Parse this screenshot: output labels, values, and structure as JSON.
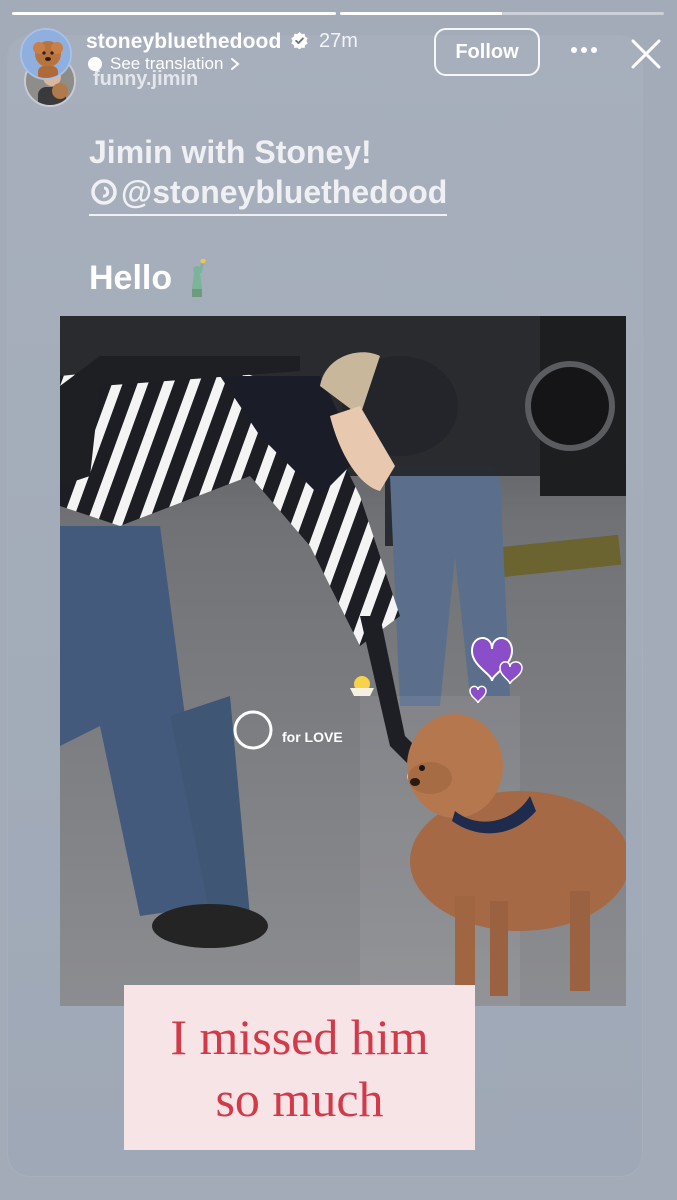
{
  "story": {
    "progress": [
      1.0,
      0.5,
      0.0
    ],
    "username": "stoneybluethedood",
    "time_ago": "27m",
    "see_translation": "See translation",
    "follow_label": "Follow",
    "source_handle": "funny.jimin"
  },
  "post": {
    "headline": "Jimin with Stoney!",
    "mention": "@stoneybluethedood",
    "hello": "Hello",
    "sticker_text": "for LOVE",
    "caption_line1": "I missed him",
    "caption_line2": "so much"
  },
  "colors": {
    "background": "#a3abb8",
    "caption_bg": "#f6e4e6",
    "caption_text": "#d23a4a",
    "heart": "#8a4fc8",
    "verified": "#3897f0"
  },
  "icons": {
    "verified": "verified-badge-icon",
    "more": "more-horizontal-icon",
    "close": "close-icon",
    "threads": "threads-icon",
    "statue": "statue-of-liberty-emoji",
    "chick": "chick-emoji",
    "hearts": "purple-heart-icon"
  }
}
